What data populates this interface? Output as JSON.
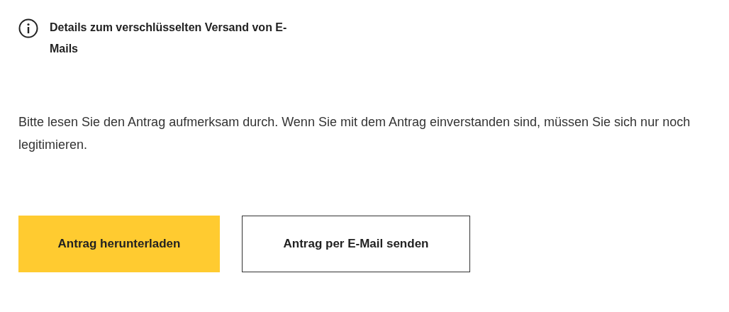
{
  "info_link": {
    "text": "Details zum verschlüsselten Versand von E-Mails"
  },
  "instruction": "Bitte lesen Sie den Antrag aufmerksam durch. Wenn Sie mit dem Antrag einverstanden sind, müssen Sie sich nur noch legitimieren.",
  "buttons": [
    {
      "label": "Antrag herunterladen",
      "kind": "primary"
    },
    {
      "label": "Antrag per E-Mail senden",
      "kind": "secondary"
    }
  ]
}
